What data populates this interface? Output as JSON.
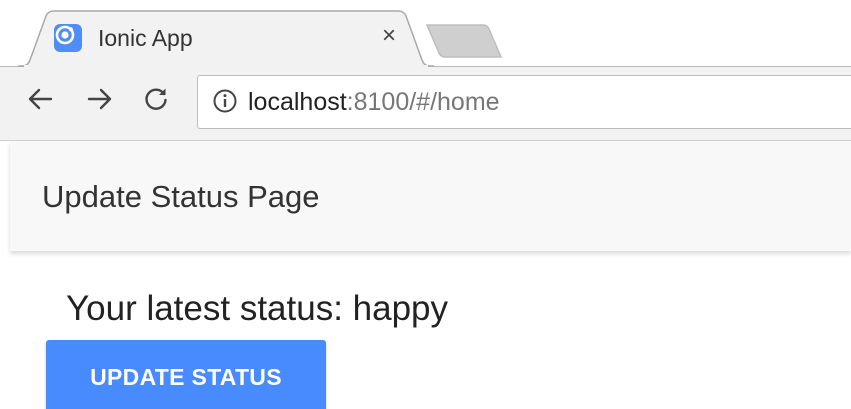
{
  "browser": {
    "tab": {
      "title": "Ionic App",
      "favicon_icon": "ionic-logo-icon",
      "close_glyph": "×"
    },
    "new_tab_icon": "new-tab-icon",
    "nav": {
      "back_icon": "back-arrow-icon",
      "forward_icon": "forward-arrow-icon",
      "reload_icon": "reload-icon"
    },
    "address_bar": {
      "info_icon": "info-icon",
      "host": "localhost",
      "rest": ":8100/#/home"
    }
  },
  "app": {
    "header_title": "Update Status Page",
    "status_text": "Your latest status: happy",
    "update_button_label": "UPDATE STATUS"
  },
  "colors": {
    "primary": "#488aff",
    "header_bg": "#f8f8f8",
    "toolbar_bg": "#f2f2f2"
  }
}
